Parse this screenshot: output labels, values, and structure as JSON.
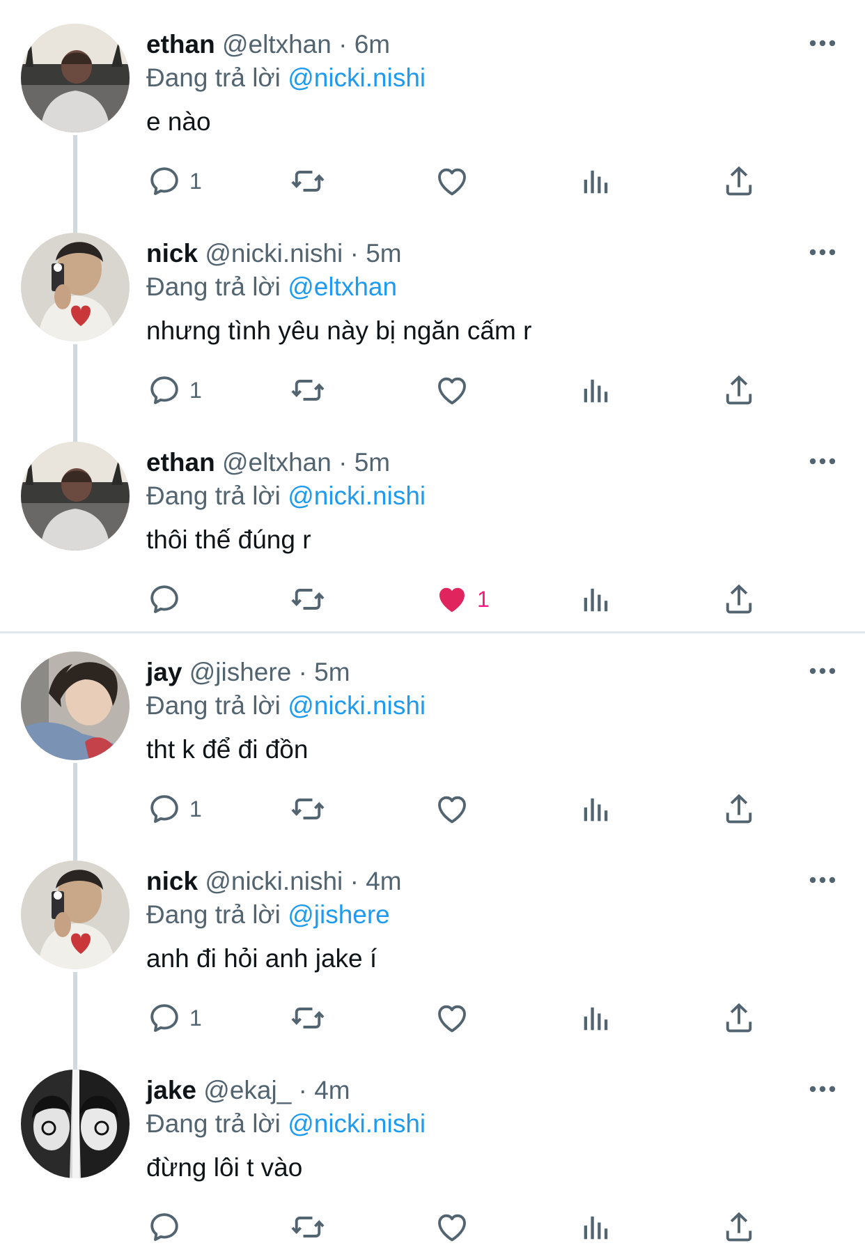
{
  "reply_prefix": "Đang trả lời",
  "accent": "#1d9bf0",
  "like_color": "#f91880",
  "tweets": [
    {
      "name": "ethan",
      "handle": "@eltxhan",
      "dot": "·",
      "time": "6m",
      "reply_to": "@nicki.nishi",
      "text": "e nào",
      "reply_count": "1",
      "like_count": "",
      "liked": false,
      "avatar": "avatar-ethan"
    },
    {
      "name": "nick",
      "handle": "@nicki.nishi",
      "dot": "·",
      "time": "5m",
      "reply_to": "@eltxhan",
      "text": "nhưng tình yêu này bị ngăn cấm r",
      "reply_count": "1",
      "like_count": "",
      "liked": false,
      "avatar": "avatar-nick"
    },
    {
      "name": "ethan",
      "handle": "@eltxhan",
      "dot": "·",
      "time": "5m",
      "reply_to": "@nicki.nishi",
      "text": "thôi thế đúng r",
      "reply_count": "",
      "like_count": "1",
      "liked": true,
      "avatar": "avatar-ethan"
    },
    {
      "name": "jay",
      "handle": "@jishere",
      "dot": "·",
      "time": "5m",
      "reply_to": "@nicki.nishi",
      "text": "tht k để đi đồn",
      "reply_count": "1",
      "like_count": "",
      "liked": false,
      "avatar": "avatar-jay"
    },
    {
      "name": "nick",
      "handle": "@nicki.nishi",
      "dot": "·",
      "time": "4m",
      "reply_to": "@jishere",
      "text": "anh đi hỏi anh jake í",
      "reply_count": "1",
      "like_count": "",
      "liked": false,
      "avatar": "avatar-nick"
    },
    {
      "name": "jake",
      "handle": "@ekaj_",
      "dot": "·",
      "time": "4m",
      "reply_to": "@nicki.nishi",
      "text": "đừng lôi t vào",
      "reply_count": "",
      "like_count": "",
      "liked": false,
      "avatar": "avatar-jake"
    }
  ]
}
